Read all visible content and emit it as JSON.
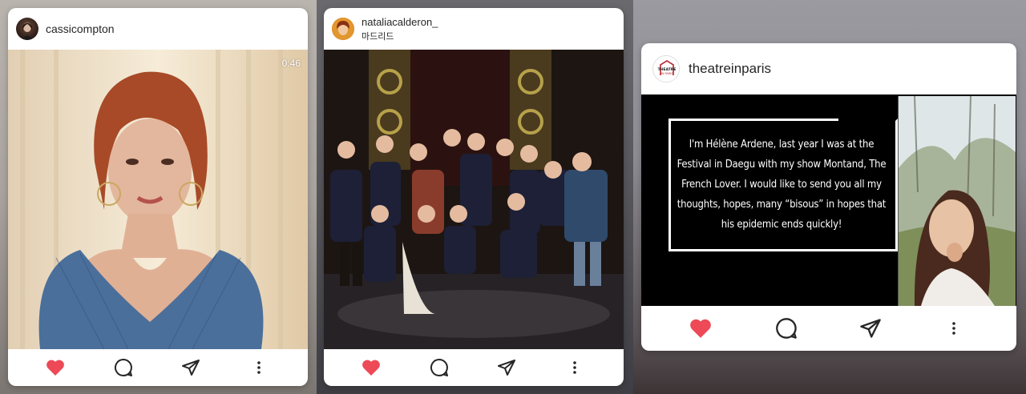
{
  "colors": {
    "like_red": "#ed4956",
    "icon_dark": "#262626"
  },
  "cards": [
    {
      "username": "cassicompton",
      "timer": "0:46",
      "actions": {
        "like": "heart-icon",
        "comment": "comment-icon",
        "share": "send-icon",
        "more": "more-icon"
      }
    },
    {
      "username": "nataliacalderon_",
      "location": "마드리드",
      "actions": {
        "like": "heart-icon",
        "comment": "comment-icon",
        "share": "send-icon",
        "more": "more-icon"
      }
    },
    {
      "username": "theatreinparis",
      "avatar_text": "THEATRE IN PARIS",
      "quote": "I'm Hélène Ardene, last year I was at the Festival in Daegu with my show Montand, The French Lover. I would like to send you all my thoughts, hopes, many “bisous” in hopes that his epidemic ends quickly!",
      "actions": {
        "like": "heart-icon",
        "comment": "comment-icon",
        "share": "send-icon",
        "more": "more-icon"
      }
    }
  ]
}
